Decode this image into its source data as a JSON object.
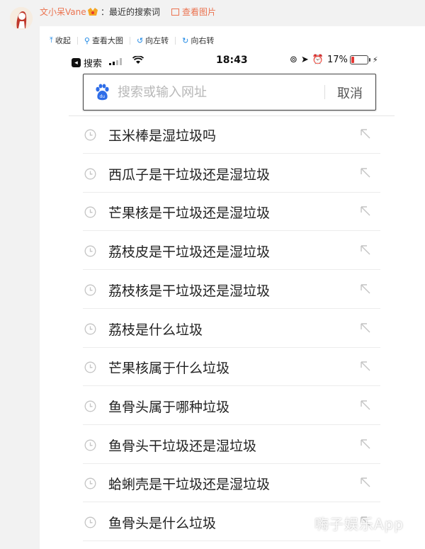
{
  "post": {
    "author": "文小呆Vane",
    "text": "：最近的搜索词",
    "view_pic": "查看图片"
  },
  "toolbar": {
    "collapse": "收起",
    "view_large": "查看大图",
    "rotate_left": "向左转",
    "rotate_right": "向右转"
  },
  "status": {
    "back_app": "搜索",
    "time": "18:43",
    "battery": "17%",
    "battery_level": 0.17
  },
  "search": {
    "placeholder": "搜索或输入网址",
    "cancel": "取消"
  },
  "history": [
    "玉米棒是湿垃圾吗",
    "西瓜子是干垃圾还是湿垃圾",
    "芒果核是干垃圾还是湿垃圾",
    "荔枝皮是干垃圾还是湿垃圾",
    "荔枝核是干垃圾还是湿垃圾",
    "荔枝是什么垃圾",
    "芒果核属于什么垃圾",
    "鱼骨头属于哪种垃圾",
    "鱼骨头干垃圾还是湿垃圾",
    "蛤蜊壳是干垃圾还是湿垃圾",
    "鱼骨头是什么垃圾"
  ],
  "watermark": "嗨子娱乐App",
  "colors": {
    "accent": "#eb7350",
    "link": "#1e88e5",
    "battery_low": "#e53935"
  }
}
